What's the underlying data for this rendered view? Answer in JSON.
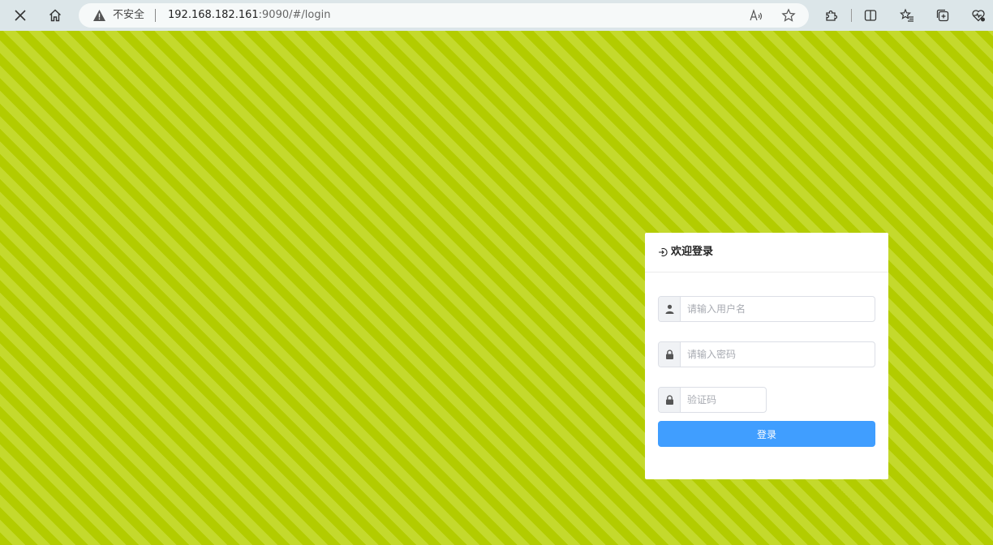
{
  "browser": {
    "security_label": "不安全",
    "url_host": "192.168.182.161",
    "url_rest": ":9090/#/login",
    "icons": {
      "close": "close-icon",
      "home": "home-icon",
      "warning": "warning-icon",
      "read_aloud": "read-aloud-icon",
      "favorite": "star-icon",
      "extensions": "puzzle-icon",
      "split_screen": "split-screen-icon",
      "favorites_list": "favorites-icon",
      "collections": "collections-icon",
      "browser_essentials": "heart-pulse-icon"
    }
  },
  "page": {
    "background_colors": [
      "#b3cc00",
      "#c4d92c"
    ]
  },
  "login": {
    "title": "欢迎登录",
    "username_placeholder": "请输入用户名",
    "password_placeholder": "请输入密码",
    "captcha_placeholder": "验证码",
    "username_value": "",
    "password_value": "",
    "captcha_value": "",
    "submit_label": "登录",
    "accent_color": "#409eff"
  }
}
